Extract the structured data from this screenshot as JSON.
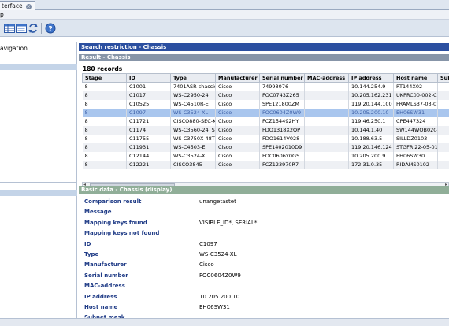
{
  "window": {
    "tab_label": "terface",
    "menu_label": "p"
  },
  "toolbar": {
    "buttons": [
      {
        "name": "grid-view-icon"
      },
      {
        "name": "form-view-icon"
      },
      {
        "name": "refresh-icon"
      },
      {
        "name": "help-icon"
      }
    ]
  },
  "nav": {
    "label": "avigation"
  },
  "search": {
    "title": "Search restriction - Chassis"
  },
  "result": {
    "title": "Result - Chassis",
    "count": "180 records",
    "columns": [
      "Stage",
      "ID",
      "Type",
      "Manufacturer",
      "Serial number",
      "MAC-address",
      "IP address",
      "Host name",
      "Sub"
    ],
    "rows": [
      [
        "8",
        "C1001",
        "7401ASR chassis, mu",
        "Cisco",
        "74998076",
        "",
        "10.144.254.9",
        "RT144X02",
        ""
      ],
      [
        "8",
        "C1017",
        "WS-C2950-24",
        "Cisco",
        "FOC0743Z265",
        "",
        "10.205.162.231",
        "UKPRC00-002-C29-I0",
        ""
      ],
      [
        "8",
        "C10525",
        "WS-C4510R-E",
        "Cisco",
        "SPE121800ZM",
        "",
        "119.20.144.100",
        "FRAMLS37-03-01-01",
        ""
      ],
      [
        "8",
        "C1097",
        "WS-C3524-XL",
        "Cisco",
        "FOC0604Z0W9",
        "",
        "10.205.200.10",
        "EH06SW31",
        ""
      ],
      [
        "8",
        "C11721",
        "CISCO880-SEC-K9",
        "Cisco",
        "FCZ154492HY",
        "",
        "119.46.250.1",
        "CPE447324",
        ""
      ],
      [
        "8",
        "C1174",
        "WS-C3560-24TS-E",
        "Cisco",
        "FDO1318X2QP",
        "",
        "10.144.1.40",
        "SW144WOB02040",
        ""
      ],
      [
        "8",
        "C11755",
        "WS-C3750X-48T-L",
        "Cisco",
        "FDO1614V028",
        "",
        "10.188.63.5",
        "SILLDZ0103",
        ""
      ],
      [
        "8",
        "C11931",
        "WS-C4503-E",
        "Cisco",
        "SPE1402010D9",
        "",
        "119.20.146.124",
        "STGFRI22-05-01-02-4",
        ""
      ],
      [
        "8",
        "C12144",
        "WS-C3524-XL",
        "Cisco",
        "FOC0606Y0GS",
        "",
        "10.205.200.9",
        "EH06SW30",
        ""
      ],
      [
        "8",
        "C12221",
        "CISCO3845",
        "Cisco",
        "FCZ123970R7",
        "",
        "172.31.0.35",
        "RIDAMS0102",
        ""
      ]
    ],
    "selected_index": 3
  },
  "basic": {
    "title": "Basic data - Chassis (display)",
    "fields": [
      {
        "label": "Comparison result",
        "value": "unangetastet"
      },
      {
        "label": "Message",
        "value": ""
      },
      {
        "label": "Mapping keys found",
        "value": "VISIBLE_ID*, SERIAL*"
      },
      {
        "label": "Mapping keys not found",
        "value": ""
      },
      {
        "label": "ID",
        "value": "C1097"
      },
      {
        "label": "Type",
        "value": "WS-C3524-XL"
      },
      {
        "label": "Manufacturer",
        "value": "Cisco"
      },
      {
        "label": "Serial number",
        "value": "FOC0604Z0W9"
      },
      {
        "label": "MAC-address",
        "value": ""
      },
      {
        "label": "IP address",
        "value": "10.205.200.10"
      },
      {
        "label": "Host name",
        "value": "EH06SW31"
      },
      {
        "label": "Subnet mask",
        "value": ""
      }
    ]
  },
  "colors": {
    "header_dark": "#2b4fa0",
    "header_mid": "#8795a8",
    "header_green": "#90ae98",
    "selected_row": "#a9c6ee",
    "label_blue": "#1f3b86"
  }
}
